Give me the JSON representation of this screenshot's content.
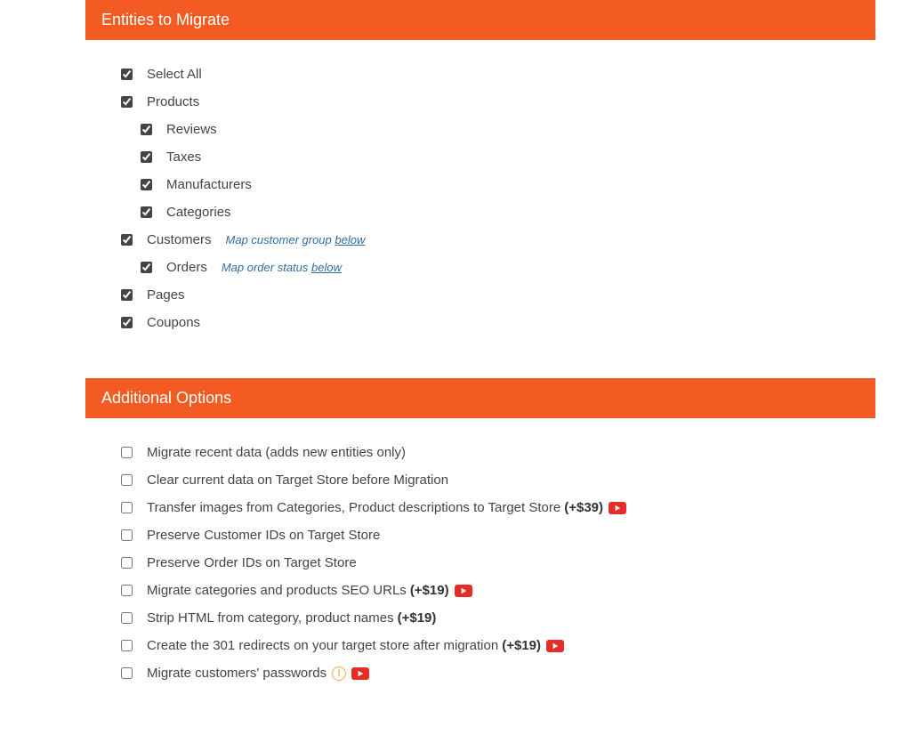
{
  "colors": {
    "accent": "#f45b22",
    "link": "#2e6da4",
    "youtube": "#e52d27",
    "warn": "#f0ad4e"
  },
  "entities": {
    "header": "Entities to Migrate",
    "items": [
      {
        "id": "select-all",
        "label": "Select All",
        "checked": true,
        "indent": 0
      },
      {
        "id": "products",
        "label": "Products",
        "checked": true,
        "indent": 0
      },
      {
        "id": "reviews",
        "label": "Reviews",
        "checked": true,
        "indent": 1
      },
      {
        "id": "taxes",
        "label": "Taxes",
        "checked": true,
        "indent": 1
      },
      {
        "id": "manufacturers",
        "label": "Manufacturers",
        "checked": true,
        "indent": 1
      },
      {
        "id": "categories",
        "label": "Categories",
        "checked": true,
        "indent": 1
      },
      {
        "id": "customers",
        "label": "Customers",
        "checked": true,
        "indent": 0,
        "hint_text": "Map customer group ",
        "hint_link": "below"
      },
      {
        "id": "orders",
        "label": "Orders",
        "checked": true,
        "indent": 1,
        "hint_text": "Map order status ",
        "hint_link": "below"
      },
      {
        "id": "pages",
        "label": "Pages",
        "checked": true,
        "indent": 0
      },
      {
        "id": "coupons",
        "label": "Coupons",
        "checked": true,
        "indent": 0
      }
    ]
  },
  "options": {
    "header": "Additional Options",
    "items": [
      {
        "id": "migrate-recent",
        "label": "Migrate recent data (adds new entities only)",
        "checked": false
      },
      {
        "id": "clear-data",
        "label": "Clear current data on Target Store before Migration",
        "checked": false
      },
      {
        "id": "transfer-images",
        "label": "Transfer images from Categories, Product descriptions to Target Store",
        "checked": false,
        "price": "(+$39)",
        "youtube": true
      },
      {
        "id": "preserve-customer-ids",
        "label": "Preserve Customer IDs on Target Store",
        "checked": false
      },
      {
        "id": "preserve-order-ids",
        "label": "Preserve Order IDs on Target Store",
        "checked": false
      },
      {
        "id": "migrate-seo",
        "label": "Migrate categories and products SEO URLs",
        "checked": false,
        "price": "(+$19)",
        "youtube": true
      },
      {
        "id": "strip-html",
        "label": "Strip HTML from category, product names",
        "checked": false,
        "price": "(+$19)"
      },
      {
        "id": "create-301",
        "label": "Create the 301 redirects on your target store after migration",
        "checked": false,
        "price": "(+$19)",
        "youtube": true
      },
      {
        "id": "migrate-passwords",
        "label": "Migrate customers' passwords",
        "checked": false,
        "warn": true,
        "youtube": true
      }
    ]
  }
}
